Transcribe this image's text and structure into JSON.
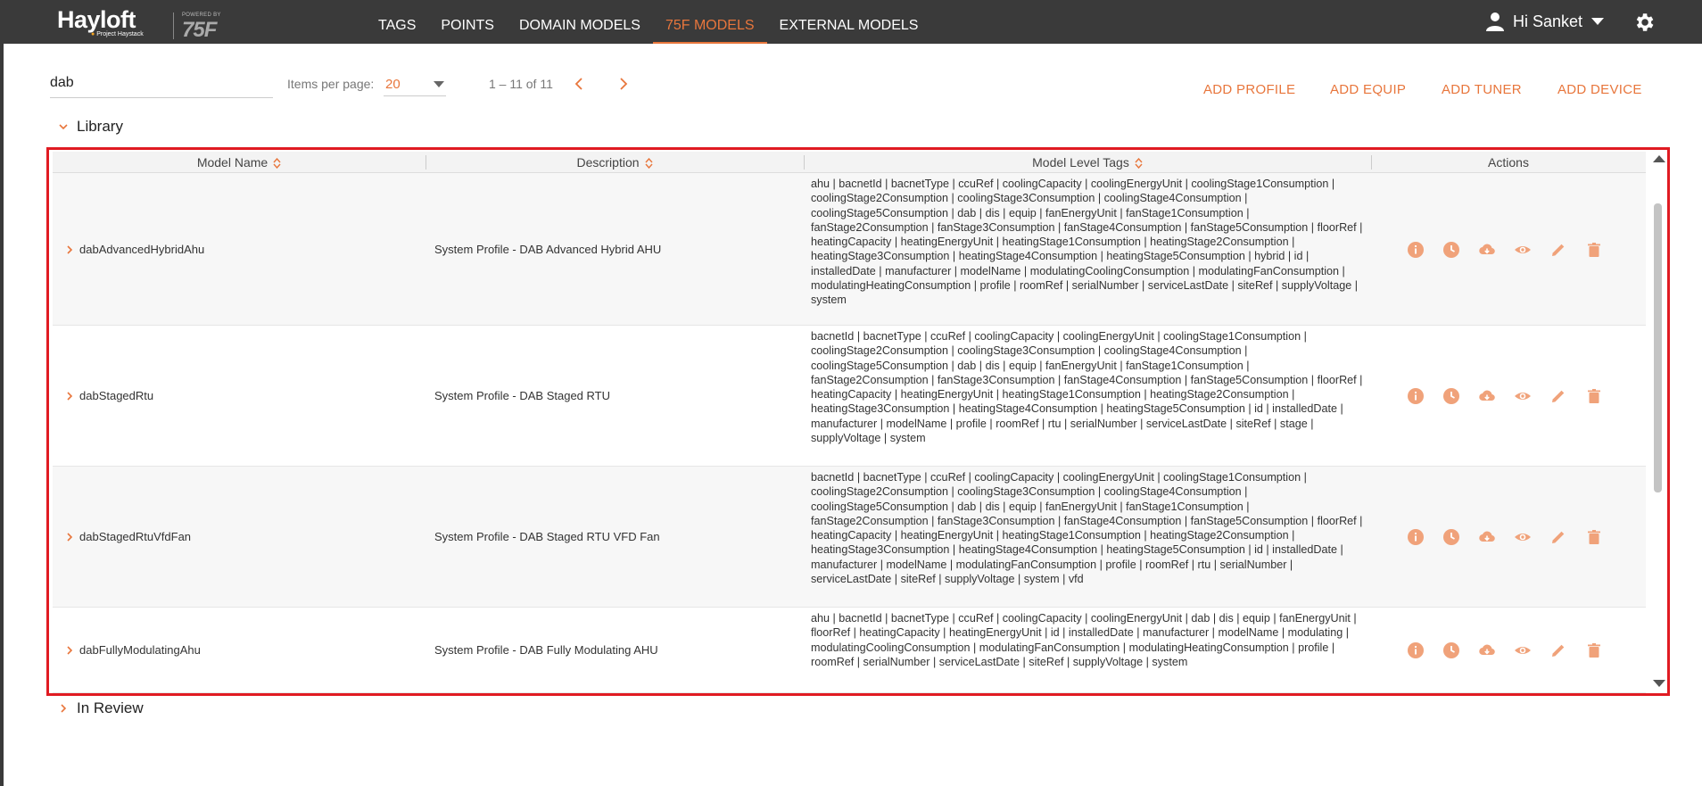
{
  "brand": {
    "name": "Hayloft",
    "subtitle": "Project Haystack",
    "powered_by": "POWERED BY",
    "partner": "75F"
  },
  "nav": {
    "items": [
      {
        "label": "TAGS",
        "active": false
      },
      {
        "label": "POINTS",
        "active": false
      },
      {
        "label": "DOMAIN MODELS",
        "active": false
      },
      {
        "label": "75F MODELS",
        "active": true
      },
      {
        "label": "EXTERNAL MODELS",
        "active": false
      }
    ]
  },
  "user": {
    "greeting": "Hi Sanket"
  },
  "toolbar": {
    "search_value": "dab",
    "items_per_page_label": "Items per page:",
    "items_per_page_value": "20",
    "range_text": "1 – 11 of 11",
    "buttons": [
      "ADD PROFILE",
      "ADD EQUIP",
      "ADD TUNER",
      "ADD DEVICE"
    ]
  },
  "sections": {
    "library": "Library",
    "in_review": "In Review"
  },
  "table": {
    "columns": [
      "Model Name",
      "Description",
      "Model Level Tags",
      "Actions"
    ],
    "action_icons": [
      "info-icon",
      "history-icon",
      "cloud-download-icon",
      "eye-icon",
      "edit-icon",
      "delete-icon"
    ],
    "rows": [
      {
        "name": "dabAdvancedHybridAhu",
        "description": "System Profile - DAB Advanced Hybrid AHU",
        "tags": "ahu | bacnetId | bacnetType | ccuRef | coolingCapacity | coolingEnergyUnit | coolingStage1Consumption | coolingStage2Consumption | coolingStage3Consumption | coolingStage4Consumption | coolingStage5Consumption | dab | dis | equip | fanEnergyUnit | fanStage1Consumption | fanStage2Consumption | fanStage3Consumption | fanStage4Consumption | fanStage5Consumption | floorRef | heatingCapacity | heatingEnergyUnit | heatingStage1Consumption | heatingStage2Consumption | heatingStage3Consumption | heatingStage4Consumption | heatingStage5Consumption | hybrid | id | installedDate | manufacturer | modelName | modulatingCoolingConsumption | modulatingFanConsumption | modulatingHeatingConsumption | profile | roomRef | serialNumber | serviceLastDate | siteRef | supplyVoltage | system"
      },
      {
        "name": "dabStagedRtu",
        "description": "System Profile - DAB Staged RTU",
        "tags": "bacnetId | bacnetType | ccuRef | coolingCapacity | coolingEnergyUnit | coolingStage1Consumption | coolingStage2Consumption | coolingStage3Consumption | coolingStage4Consumption | coolingStage5Consumption | dab | dis | equip | fanEnergyUnit | fanStage1Consumption | fanStage2Consumption | fanStage3Consumption | fanStage4Consumption | fanStage5Consumption | floorRef | heatingCapacity | heatingEnergyUnit | heatingStage1Consumption | heatingStage2Consumption | heatingStage3Consumption | heatingStage4Consumption | heatingStage5Consumption | id | installedDate | manufacturer | modelName | profile | roomRef | rtu | serialNumber | serviceLastDate | siteRef | stage | supplyVoltage | system"
      },
      {
        "name": "dabStagedRtuVfdFan",
        "description": "System Profile - DAB Staged RTU VFD Fan",
        "tags": "bacnetId | bacnetType | ccuRef | coolingCapacity | coolingEnergyUnit | coolingStage1Consumption | coolingStage2Consumption | coolingStage3Consumption | coolingStage4Consumption | coolingStage5Consumption | dab | dis | equip | fanEnergyUnit | fanStage1Consumption | fanStage2Consumption | fanStage3Consumption | fanStage4Consumption | fanStage5Consumption | floorRef | heatingCapacity | heatingEnergyUnit | heatingStage1Consumption | heatingStage2Consumption | heatingStage3Consumption | heatingStage4Consumption | heatingStage5Consumption | id | installedDate | manufacturer | modelName | modulatingFanConsumption | profile | roomRef | rtu | serialNumber | serviceLastDate | siteRef | supplyVoltage | system | vfd"
      },
      {
        "name": "dabFullyModulatingAhu",
        "description": "System Profile - DAB Fully Modulating AHU",
        "tags": "ahu | bacnetId | bacnetType | ccuRef | coolingCapacity | coolingEnergyUnit | dab | dis | equip | fanEnergyUnit | floorRef | heatingCapacity | heatingEnergyUnit | id | installedDate | manufacturer | modelName | modulating | modulatingCoolingConsumption | modulatingFanConsumption | modulatingHeatingConsumption | profile | roomRef | serialNumber | serviceLastDate | siteRef | supplyVoltage | system"
      }
    ]
  },
  "colors": {
    "accent": "#e8763c",
    "nav_bg": "#3a3a3a",
    "highlight_frame": "#e01b22",
    "icon": "#f0a27a"
  }
}
